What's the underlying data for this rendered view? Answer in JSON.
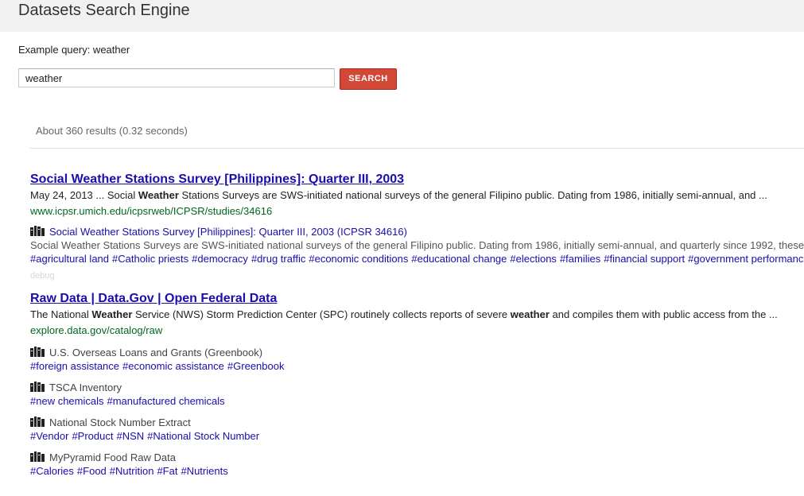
{
  "header": {
    "title": "Datasets Search Engine"
  },
  "search": {
    "example_label": "Example query: weather",
    "query": "weather",
    "button_label": "SEARCH"
  },
  "stats": "About 360 results (0.32 seconds)",
  "results": [
    {
      "title": "Social Weather Stations Survey [Philippines]: Quarter III, 2003",
      "snippet": [
        {
          "t": "May 24, 2013 ... Social ",
          "b": false
        },
        {
          "t": "Weather",
          "b": true
        },
        {
          "t": " Stations Surveys are SWS-initiated national surveys of the general Filipino public. Dating from 1986, initially semi-annual, and ...",
          "b": false
        }
      ],
      "url": "www.icpsr.umich.edu/icpsrweb/ICPSR/studies/34616",
      "sub": {
        "icon": "book-icon",
        "link": "Social Weather Stations Survey [Philippines]: Quarter III, 2003 (ICPSR 34616)",
        "desc": "Social Weather Stations Surveys are SWS-initiated national surveys of the general Filipino public. Dating from 1986, initially semi-annual, and quarterly since 1992, these",
        "tags": [
          "#agricultural land",
          "#Catholic priests",
          "#democracy",
          "#drug traffic",
          "#economic conditions",
          "#educational change",
          "#elections",
          "#families",
          "#financial support",
          "#government performance"
        ]
      },
      "debug": "debug"
    },
    {
      "title": "Raw Data | Data.Gov | Open Federal Data",
      "snippet": [
        {
          "t": "The National ",
          "b": false
        },
        {
          "t": "Weather",
          "b": true
        },
        {
          "t": " Service (NWS) Storm Prediction Center (SPC) routinely collects reports of severe ",
          "b": false
        },
        {
          "t": "weather",
          "b": true
        },
        {
          "t": " and compiles them with public access from the  ...",
          "b": false
        }
      ],
      "url": "explore.data.gov/catalog/raw",
      "items": [
        {
          "icon": "book-icon",
          "name": "U.S. Overseas Loans and Grants (Greenbook)",
          "tags": [
            "#foreign assistance",
            "#economic assistance",
            "#Greenbook"
          ]
        },
        {
          "icon": "book-icon",
          "name": "TSCA Inventory",
          "tags": [
            "#new chemicals",
            "#manufactured chemicals"
          ]
        },
        {
          "icon": "book-icon",
          "name": "National Stock Number Extract",
          "tags": [
            "#Vendor",
            "#Product",
            "#NSN",
            "#National Stock Number"
          ]
        },
        {
          "icon": "book-icon",
          "name": "MyPyramid Food Raw Data",
          "tags": [
            "#Calories",
            "#Food",
            "#Nutrition",
            "#Fat",
            "#Nutrients"
          ]
        }
      ]
    }
  ]
}
